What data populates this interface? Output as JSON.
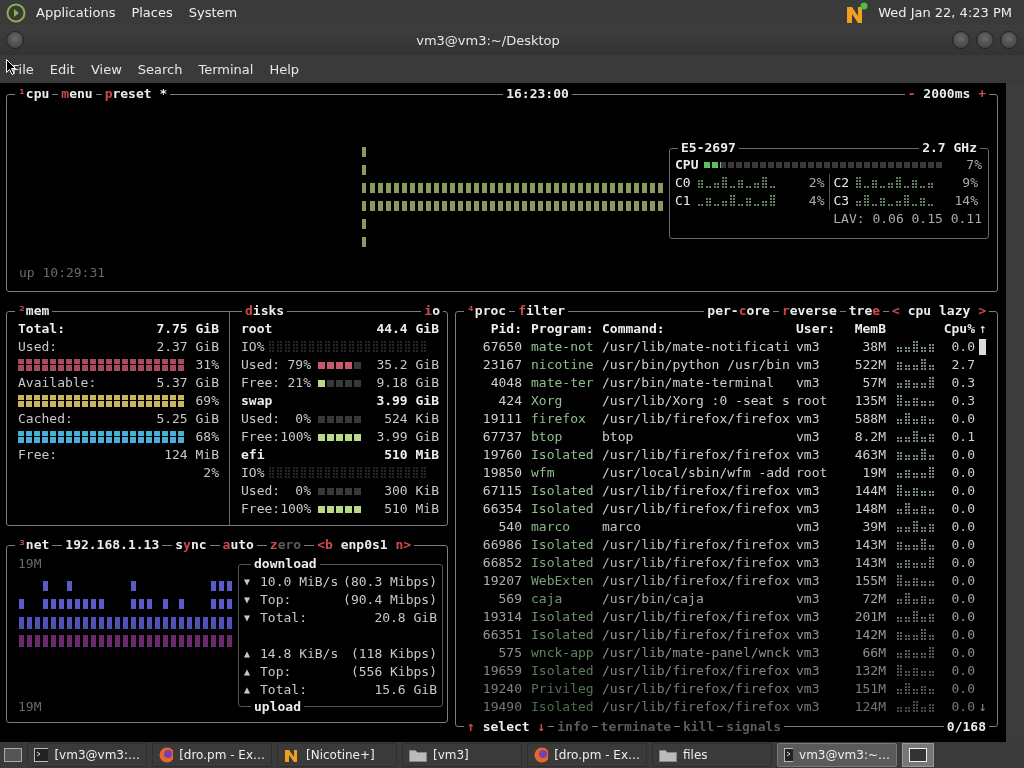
{
  "top_panel": {
    "menus": [
      "Applications",
      "Places",
      "System"
    ],
    "clock": "Wed Jan 22, 4:23 PM"
  },
  "window": {
    "title": "vm3@vm3:~/Desktop"
  },
  "menu_bar": [
    "File",
    "Edit",
    "View",
    "Search",
    "Terminal",
    "Help"
  ],
  "cpu_box": {
    "header_left": [
      {
        "parts": [
          {
            "text": "¹",
            "hot": true
          },
          {
            "text": "cpu",
            "hot": false
          }
        ]
      },
      {
        "parts": [
          {
            "text": "m",
            "hot": true
          },
          {
            "text": "enu",
            "hot": false
          }
        ]
      },
      {
        "parts": [
          {
            "text": "p",
            "hot": true
          },
          {
            "text": "reset *",
            "hot": false
          }
        ]
      }
    ],
    "clock": "16:23:00",
    "header_right": [
      {
        "parts": [
          {
            "text": "-",
            "hot": true
          },
          {
            "text": " 2000ms ",
            "hot": false
          },
          {
            "text": "+",
            "hot": true
          }
        ]
      }
    ],
    "uptime": "up 10:29:31",
    "model": "E5-2697",
    "frequency": "2.7 GHz",
    "total": {
      "label": "CPU",
      "level": 0.07,
      "reading": "7%"
    },
    "cores": [
      {
        "name": "C0",
        "reading": "2%"
      },
      {
        "name": "C1",
        "reading": "4%"
      },
      {
        "name": "C2",
        "reading": "9%"
      },
      {
        "name": "C3",
        "reading": "14%"
      }
    ],
    "load_average": "LAV: 0.06 0.15 0.11"
  },
  "mem_box": {
    "header": {
      "parts": [
        {
          "text": "²",
          "hot": true
        },
        {
          "text": "mem",
          "hot": false
        }
      ]
    },
    "rows": [
      {
        "label": "Total:",
        "value": "7.75 GiB",
        "kind": "total"
      },
      {
        "label": "Used:",
        "value": "2.37 GiB",
        "kind": "stat",
        "color": "#a84a5c",
        "reading": "31%"
      },
      {
        "label": "Available:",
        "value": "5.37 GiB",
        "kind": "stat",
        "color": "#c9b45a",
        "reading": "69%"
      },
      {
        "label": "Cached:",
        "value": "5.25 GiB",
        "kind": "stat",
        "color": "#4ab0d8",
        "reading": "68%"
      },
      {
        "label": "Free:",
        "value": "124 MiB",
        "kind": "stat",
        "reading": "2%"
      }
    ]
  },
  "disks_box": {
    "header_left": {
      "parts": [
        {
          "text": "d",
          "hot": true
        },
        {
          "text": "isks",
          "hot": false
        }
      ]
    },
    "header_right": {
      "parts": [
        {
          "text": "i",
          "hot": true
        },
        {
          "text": "o",
          "hot": false
        }
      ]
    },
    "disks": [
      {
        "name": "root",
        "size": "44.4 GiB",
        "io_label": "IO%",
        "rows": [
          {
            "label": "Used:",
            "percent": "79%",
            "level": 0.79,
            "kind": "used",
            "value": "35.2 GiB"
          },
          {
            "label": "Free:",
            "percent": "21%",
            "level": 0.21,
            "kind": "free",
            "value": "9.18 GiB"
          }
        ]
      },
      {
        "name": "swap",
        "size": "3.99 GiB",
        "rows": [
          {
            "label": "Used:",
            "percent": "0%",
            "level": 0,
            "kind": "used",
            "value": "524 KiB"
          },
          {
            "label": "Free:",
            "percent": "100%",
            "level": 1,
            "kind": "free",
            "value": "3.99 GiB"
          }
        ]
      },
      {
        "name": "efi",
        "size": "510 MiB",
        "io_label": "IO%",
        "rows": [
          {
            "label": "Used:",
            "percent": "0%",
            "level": 0,
            "kind": "used",
            "value": "300 KiB"
          },
          {
            "label": "Free:",
            "percent": "100%",
            "level": 1,
            "kind": "free",
            "value": "510 MiB"
          }
        ]
      }
    ]
  },
  "net_box": {
    "header": [
      {
        "dim": false,
        "parts": [
          {
            "text": "³",
            "hot": true
          },
          {
            "text": "net",
            "hot": false
          }
        ]
      },
      {
        "dim": false,
        "parts": [
          {
            "text": "192.168.1.13",
            "hot": false
          }
        ]
      },
      {
        "dim": false,
        "parts": [
          {
            "text": "s",
            "hot": false
          },
          {
            "text": "y",
            "hot": true
          },
          {
            "text": "nc",
            "hot": false
          }
        ]
      },
      {
        "dim": false,
        "parts": [
          {
            "text": "a",
            "hot": true
          },
          {
            "text": "uto",
            "hot": false
          }
        ]
      },
      {
        "dim": true,
        "parts": [
          {
            "text": "z",
            "hot": true
          },
          {
            "text": "ero",
            "hot": false
          }
        ]
      },
      {
        "dim": false,
        "parts": [
          {
            "text": "<b",
            "hot": true
          },
          {
            "text": " enp0s1 ",
            "hot": false
          },
          {
            "text": "n>",
            "hot": true
          }
        ]
      }
    ],
    "scale_top": "19M",
    "scale_bottom": "19M",
    "download": {
      "title": "download",
      "rows": [
        {
          "arrow": "▼",
          "label": "10.0 MiB/s",
          "value": "(80.3 Mibps)"
        },
        {
          "arrow": "▼",
          "label": "Top:",
          "value": "(90.4 Mibps)"
        },
        {
          "arrow": "▼",
          "label": "Total:",
          "value": "20.8 GiB"
        }
      ]
    },
    "upload": {
      "title": "upload",
      "rows": [
        {
          "arrow": "▲",
          "label": "14.8 KiB/s",
          "value": "(118 Kibps)"
        },
        {
          "arrow": "▲",
          "label": "Top:",
          "value": "(556 Kibps)"
        },
        {
          "arrow": "▲",
          "label": "Total:",
          "value": "15.6 GiB"
        }
      ]
    }
  },
  "proc_box": {
    "header_left": [
      {
        "parts": [
          {
            "text": "⁴",
            "hot": true
          },
          {
            "text": "proc",
            "hot": false
          }
        ]
      },
      {
        "parts": [
          {
            "text": "f",
            "hot": true
          },
          {
            "text": "ilter",
            "hot": false
          }
        ]
      }
    ],
    "header_right": [
      {
        "parts": [
          {
            "text": "per-",
            "hot": false
          },
          {
            "text": "c",
            "hot": true
          },
          {
            "text": "ore",
            "hot": false
          }
        ]
      },
      {
        "parts": [
          {
            "text": "r",
            "hot": true
          },
          {
            "text": "everse",
            "hot": false
          }
        ]
      },
      {
        "parts": [
          {
            "text": "tre",
            "hot": false
          },
          {
            "text": "e",
            "hot": true
          }
        ]
      },
      {
        "parts": [
          {
            "text": "<",
            "hot": true
          },
          {
            "text": " cpu lazy ",
            "hot": false
          },
          {
            "text": ">",
            "hot": true
          }
        ]
      }
    ],
    "columns": [
      "Pid:",
      "Program:",
      "Command:",
      "User:",
      "MemB",
      "Cpu%"
    ],
    "scroll_up": "↑",
    "scroll_down": "↓",
    "rows": [
      {
        "pid": "67650",
        "program": "mate-not",
        "command": "/usr/lib/mate-notificati",
        "user": "vm3",
        "mem": "38M",
        "cpu": "0.0"
      },
      {
        "pid": "23167",
        "program": "nicotine",
        "command": "/usr/bin/python /usr/bin",
        "user": "vm3",
        "mem": "522M",
        "cpu": "2.7"
      },
      {
        "pid": "4048",
        "program": "mate-ter",
        "command": "/usr/bin/mate-terminal",
        "user": "vm3",
        "mem": "57M",
        "cpu": "0.3"
      },
      {
        "pid": "424",
        "program": "Xorg",
        "command": "/usr/lib/Xorg :0 -seat s",
        "user": "root",
        "mem": "135M",
        "cpu": "0.3"
      },
      {
        "pid": "19111",
        "program": "firefox",
        "command": "/usr/lib/firefox/firefox",
        "user": "vm3",
        "mem": "588M",
        "cpu": "0.0"
      },
      {
        "pid": "67737",
        "program": "btop",
        "command": "btop",
        "user": "vm3",
        "mem": "8.2M",
        "cpu": "0.1"
      },
      {
        "pid": "19760",
        "program": "Isolated",
        "command": "/usr/lib/firefox/firefox",
        "user": "vm3",
        "mem": "463M",
        "cpu": "0.0"
      },
      {
        "pid": "19850",
        "program": "wfm",
        "command": "/usr/local/sbin/wfm -add",
        "user": "root",
        "mem": "19M",
        "cpu": "0.0"
      },
      {
        "pid": "67115",
        "program": "Isolated",
        "command": "/usr/lib/firefox/firefox",
        "user": "vm3",
        "mem": "144M",
        "cpu": "0.0"
      },
      {
        "pid": "66354",
        "program": "Isolated",
        "command": "/usr/lib/firefox/firefox",
        "user": "vm3",
        "mem": "148M",
        "cpu": "0.0"
      },
      {
        "pid": "540",
        "program": "marco",
        "command": "marco",
        "user": "vm3",
        "mem": "39M",
        "cpu": "0.0"
      },
      {
        "pid": "66986",
        "program": "Isolated",
        "command": "/usr/lib/firefox/firefox",
        "user": "vm3",
        "mem": "143M",
        "cpu": "0.0"
      },
      {
        "pid": "66852",
        "program": "Isolated",
        "command": "/usr/lib/firefox/firefox",
        "user": "vm3",
        "mem": "143M",
        "cpu": "0.0"
      },
      {
        "pid": "19207",
        "program": "WebExten",
        "command": "/usr/lib/firefox/firefox",
        "user": "vm3",
        "mem": "155M",
        "cpu": "0.0"
      },
      {
        "pid": "569",
        "program": "caja",
        "command": "/usr/bin/caja",
        "user": "vm3",
        "mem": "72M",
        "cpu": "0.0"
      },
      {
        "pid": "19314",
        "program": "Isolated",
        "command": "/usr/lib/firefox/firefox",
        "user": "vm3",
        "mem": "201M",
        "cpu": "0.0"
      },
      {
        "pid": "66351",
        "program": "Isolated",
        "command": "/usr/lib/firefox/firefox",
        "user": "vm3",
        "mem": "142M",
        "cpu": "0.0"
      },
      {
        "pid": "575",
        "program": "wnck-app",
        "command": "/usr/lib/mate-panel/wnck",
        "user": "vm3",
        "mem": "66M",
        "cpu": "0.0"
      },
      {
        "pid": "19659",
        "program": "Isolated",
        "command": "/usr/lib/firefox/firefox",
        "user": "vm3",
        "mem": "132M",
        "cpu": "0.0"
      },
      {
        "pid": "19240",
        "program": "Privileg",
        "command": "/usr/lib/firefox/firefox",
        "user": "vm3",
        "mem": "151M",
        "cpu": "0.0"
      },
      {
        "pid": "19490",
        "program": "Isolated",
        "command": "/usr/lib/firefox/firefox",
        "user": "vm3",
        "mem": "124M",
        "cpu": "0.0"
      }
    ],
    "footer_left": [
      {
        "dim": false,
        "parts": [
          {
            "text": "↑",
            "hot": true
          },
          {
            "text": " select ",
            "hot": false
          },
          {
            "text": "↓",
            "hot": true
          }
        ]
      },
      {
        "dim": true,
        "parts": [
          {
            "text": "info",
            "hot": false
          }
        ]
      },
      {
        "dim": true,
        "parts": [
          {
            "text": "terminate",
            "hot": false
          }
        ]
      },
      {
        "dim": true,
        "parts": [
          {
            "text": "kill",
            "hot": false
          }
        ]
      },
      {
        "dim": true,
        "parts": [
          {
            "text": "signals",
            "hot": false
          }
        ]
      }
    ],
    "footer_right": [
      {
        "parts": [
          {
            "text": "0/168",
            "hot": false
          }
        ]
      }
    ]
  },
  "taskbar": [
    {
      "label": "[vm3@vm3:…",
      "kind": "terminal",
      "selected": false
    },
    {
      "label": "[dro.pm - Ex…",
      "kind": "firefox",
      "selected": false
    },
    {
      "label": "[Nicotine+]",
      "kind": "nicotine",
      "selected": false
    },
    {
      "label": "[vm3]",
      "kind": "folder",
      "selected": false
    },
    {
      "label": "[dro.pm - Ex…",
      "kind": "firefox",
      "selected": false
    },
    {
      "label": "files",
      "kind": "folder",
      "selected": false
    },
    {
      "label": "vm3@vm3:~…",
      "kind": "terminal",
      "selected": true
    }
  ]
}
